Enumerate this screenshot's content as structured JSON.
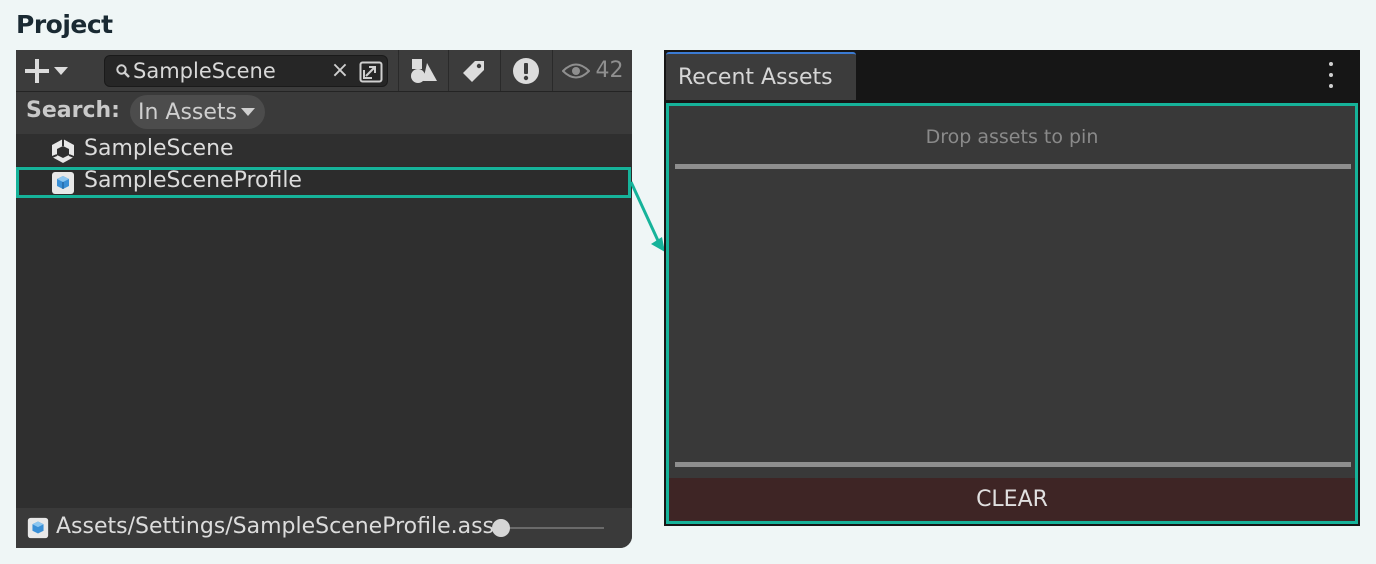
{
  "section": {
    "title": "Project"
  },
  "project": {
    "search": {
      "value": "SampleScene",
      "clear_glyph": "×"
    },
    "count": "42",
    "search_label": "Search:",
    "scope": "In Assets",
    "assets": [
      {
        "name": "SampleScene",
        "icon": "unity-scene-icon"
      },
      {
        "name": "SampleSceneProfile",
        "icon": "profile-asset-icon"
      }
    ],
    "status_path": "Assets/Settings/SampleSceneProfile.asset",
    "zoom_level": 0
  },
  "recent": {
    "tab_label": "Recent Assets",
    "drop_hint": "Drop assets to pin",
    "clear_label": "CLEAR"
  },
  "colors": {
    "highlight": "#16b39a",
    "tab_accent": "#3b7bd4",
    "clear_bg": "#3e2525"
  }
}
